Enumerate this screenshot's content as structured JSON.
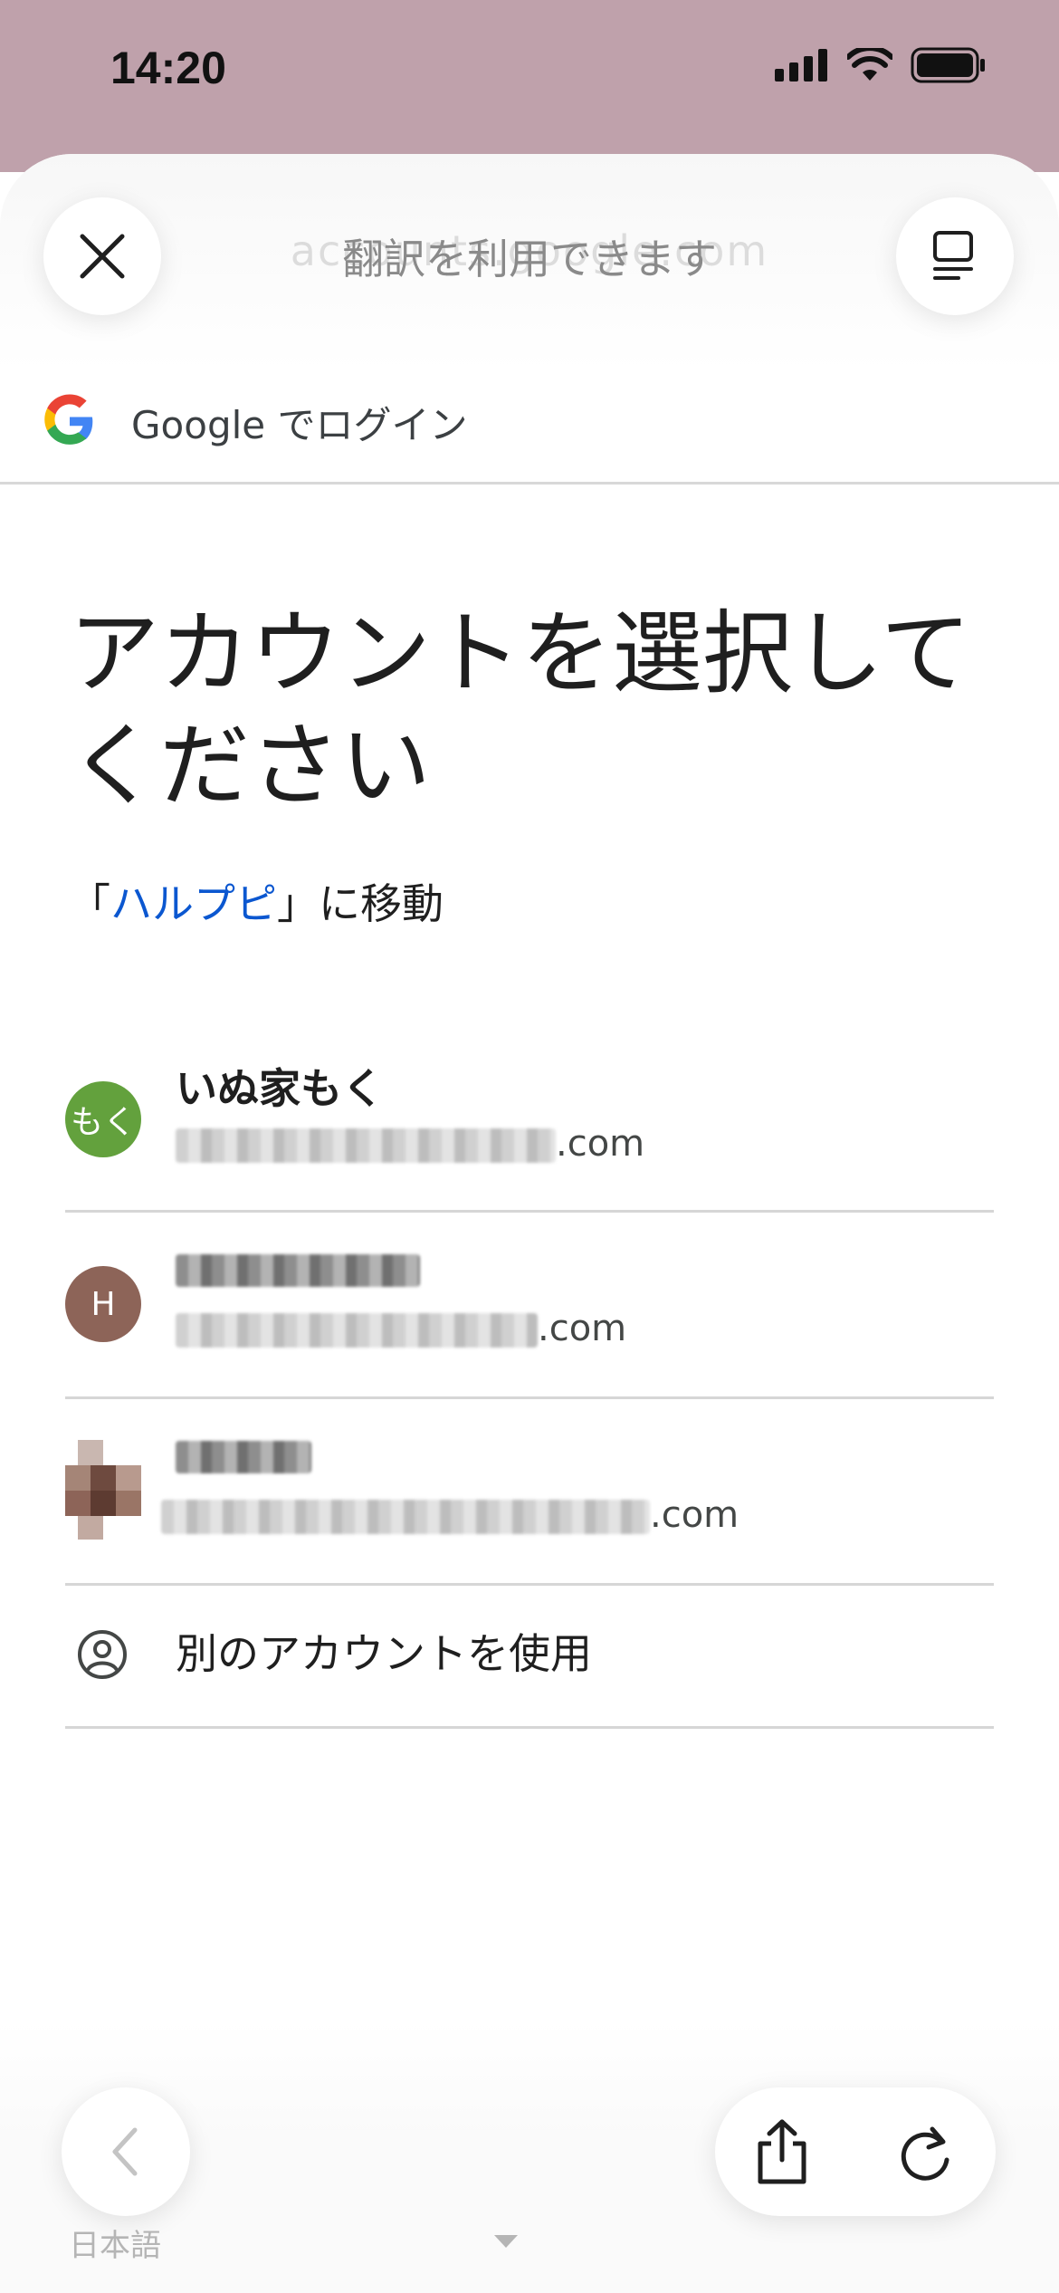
{
  "status_bar": {
    "time": "14:20"
  },
  "top": {
    "translate_note": "翻訳を利用できます",
    "url_ghost": "accounts.google.com"
  },
  "login_header": {
    "text": "Google でログイン"
  },
  "heading": "アカウントを選択してください",
  "subline": {
    "prefix": "「",
    "app_name": "ハルプピ",
    "suffix": "」に移動"
  },
  "accounts": [
    {
      "avatar_text": "もく",
      "avatar_color": "#63a13d",
      "name": "いぬ家もく",
      "email_suffix": ".com"
    },
    {
      "avatar_text": "H",
      "avatar_color": "#8d6458",
      "name": "",
      "email_suffix": ".com"
    },
    {
      "avatar_text": "",
      "avatar_color": "#6e4a3f",
      "name": "",
      "email_suffix": ".com"
    }
  ],
  "other_account": {
    "label": "別のアカウントを使用"
  },
  "footer": {
    "language": "日本語"
  },
  "colors": {
    "status_bg": "#bfa1ab",
    "link": "#0b57d0",
    "divider": "#d6d6d6"
  },
  "icons": [
    "close-icon",
    "reader-icon",
    "google-logo",
    "person-circle-icon",
    "back-chevron-icon",
    "share-icon",
    "reload-icon",
    "dropdown-caret-icon",
    "signal-icon",
    "wifi-icon",
    "battery-icon"
  ]
}
